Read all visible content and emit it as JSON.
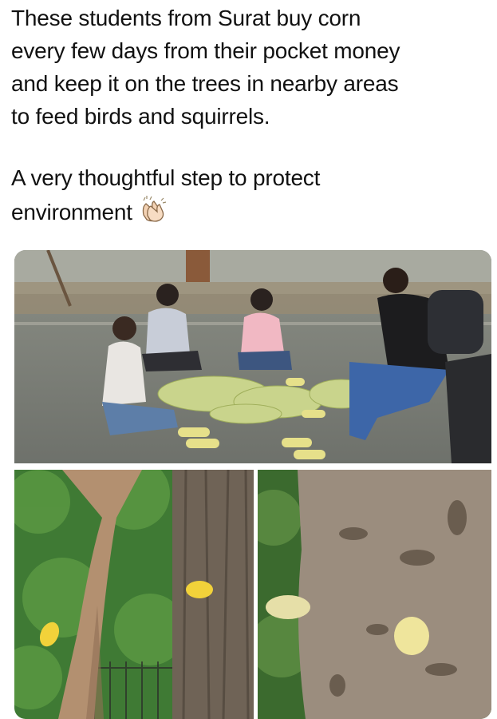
{
  "post": {
    "text_line_1": "These students from Surat buy corn",
    "text_line_2": "every few days from their pocket money",
    "text_line_3": "and keep it on the trees in nearby areas",
    "text_line_4": "to feed birds and squirrels.",
    "text_line_5": "A very thoughtful step to protect",
    "text_line_6": "environment",
    "emoji": "clapping-hands-icon"
  },
  "photos": [
    {
      "name": "students-peeling-corn-photo"
    },
    {
      "name": "corn-on-thin-tree-photo"
    },
    {
      "name": "corn-on-thick-tree-photo"
    }
  ]
}
